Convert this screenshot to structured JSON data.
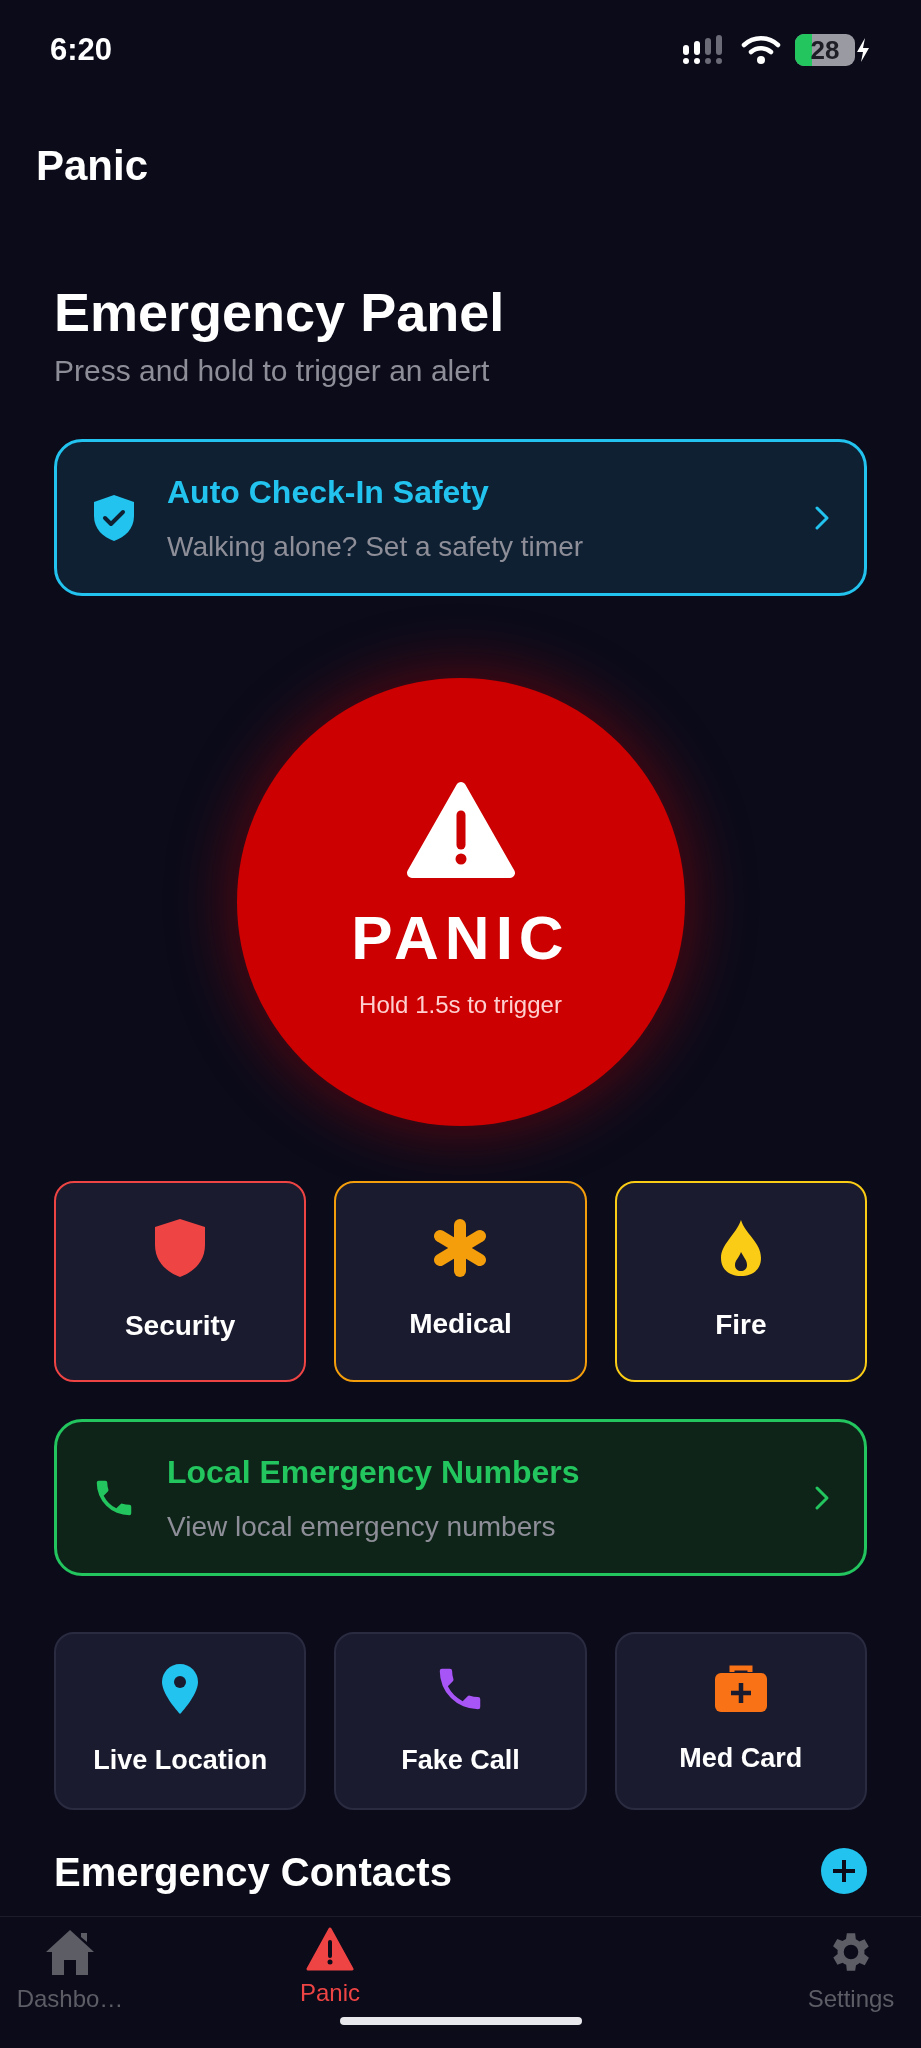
{
  "status_bar": {
    "time": "6:20",
    "battery": "28"
  },
  "header": {
    "title": "Panic"
  },
  "intro": {
    "title": "Emergency Panel",
    "subtitle": "Press and hold to trigger an alert"
  },
  "check_in": {
    "title": "Auto Check-In Safety",
    "subtitle": "Walking alone? Set a safety timer"
  },
  "panic_button": {
    "label": "PANIC",
    "hint": "Hold 1.5s to trigger"
  },
  "categories": [
    {
      "kind": "security",
      "label": "Security",
      "color": "#ef4444"
    },
    {
      "kind": "medical",
      "label": "Medical",
      "color": "#f59e0b"
    },
    {
      "kind": "fire",
      "label": "Fire",
      "color": "#facc15"
    }
  ],
  "local_numbers": {
    "title": "Local Emergency Numbers",
    "subtitle": "View local emergency numbers"
  },
  "tools": [
    {
      "kind": "location",
      "label": "Live Location"
    },
    {
      "kind": "call",
      "label": "Fake Call"
    },
    {
      "kind": "medcard",
      "label": "Med Card"
    }
  ],
  "contacts": {
    "title": "Emergency Contacts"
  },
  "tab_bar": [
    {
      "kind": "home",
      "label": "Dashbo…",
      "selected": false
    },
    {
      "kind": "panic",
      "label": "Panic",
      "selected": true
    },
    {
      "kind": "settings",
      "label": "Settings",
      "selected": false
    }
  ]
}
